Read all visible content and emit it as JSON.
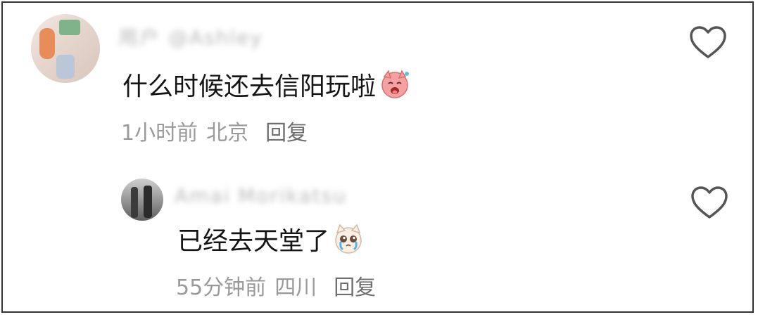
{
  "comments": [
    {
      "username": "用户 @Ashley",
      "text": "什么时候还去信阳玩啦",
      "emoji": "smiling-pink-cat-emoji",
      "time": "1小时前",
      "location": "北京",
      "reply_label": "回复",
      "like_icon": "heart-outline-icon"
    },
    {
      "username": "Amai Morikatsu",
      "text": "已经去天堂了",
      "emoji": "crying-cat-emoji",
      "time": "55分钟前",
      "location": "四川",
      "reply_label": "回复",
      "like_icon": "heart-outline-icon"
    }
  ],
  "colors": {
    "text_primary": "#151515",
    "text_meta": "#9a9a9a",
    "icon_stroke": "#555555"
  }
}
